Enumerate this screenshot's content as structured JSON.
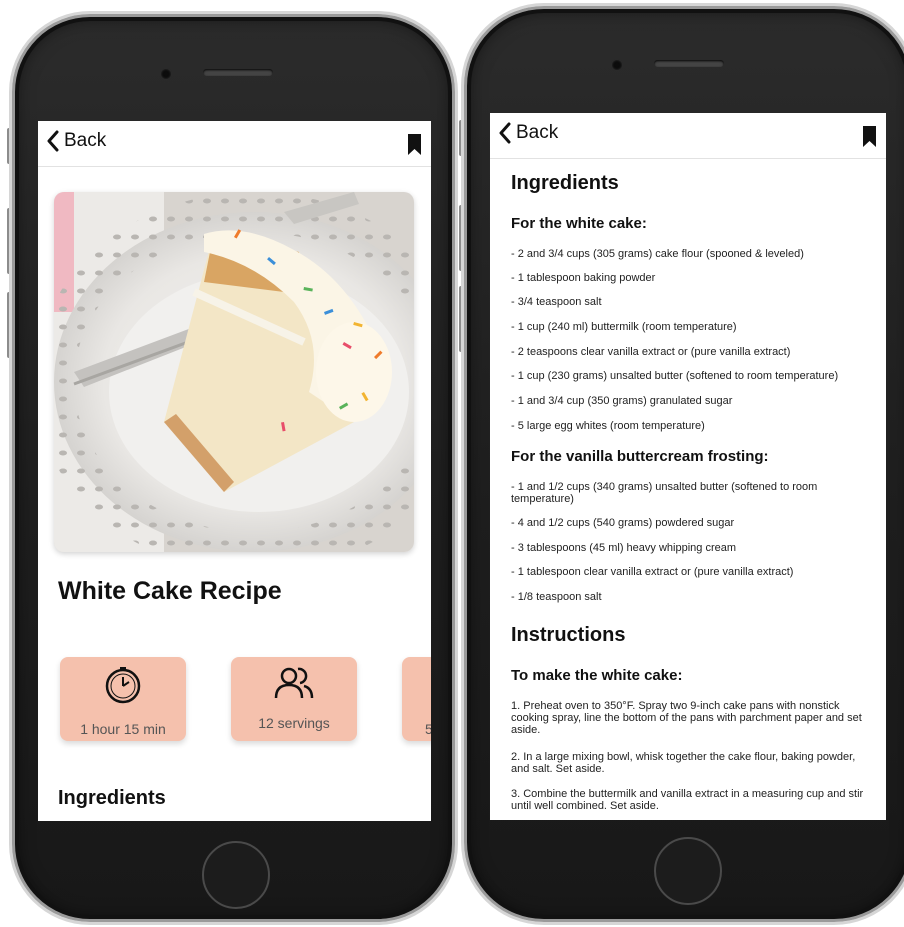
{
  "nav": {
    "back_label": "Back"
  },
  "left": {
    "title": "White Cake Recipe",
    "cards": [
      {
        "icon": "clock-icon",
        "label": "1 hour 15 min"
      },
      {
        "icon": "people-icon",
        "label": "12 servings"
      },
      {
        "icon": "",
        "label": "5"
      }
    ],
    "ingredients_heading": "Ingredients"
  },
  "right": {
    "ingredients_heading": "Ingredients",
    "white_cake_heading": "For the white cake:",
    "white_cake_items": [
      "- 2 and 3/4 cups (305 grams) cake flour (spooned & leveled)",
      "- 1 tablespoon baking powder",
      "- 3/4 teaspoon salt",
      "- 1 cup (240 ml) buttermilk (room temperature)",
      "- 2 teaspoons clear vanilla extract or (pure vanilla extract)",
      "- 1 cup (230 grams) unsalted butter (softened to room temperature)",
      "- 1 and 3/4 cup (350 grams) granulated sugar",
      "- 5 large egg whites (room temperature)"
    ],
    "frosting_heading": "For the vanilla buttercream frosting:",
    "frosting_items": [
      "- 1 and 1/2 cups (340 grams) unsalted butter (softened to room temperature)",
      "- 4 and 1/2 cups (540 grams) powdered sugar",
      "- 3 tablespoons (45 ml) heavy whipping cream",
      "- 1 tablespoon clear vanilla extract or (pure vanilla extract)",
      "- 1/8 teaspoon salt"
    ],
    "instructions_heading": "Instructions",
    "make_cake_heading": "To make the white cake:",
    "steps": [
      "1. Preheat oven to 350°F. Spray two 9-inch cake pans with nonstick cooking spray, line the bottom of the pans with parchment paper and set aside.",
      "2. In a large mixing bowl, whisk together the cake flour, baking powder, and salt. Set aside.",
      "3. Combine the buttermilk and vanilla extract in a measuring cup and stir until well combined. Set aside."
    ]
  },
  "colors": {
    "card_bg": "#f5c1ad",
    "frame": "#1e1e1e"
  }
}
